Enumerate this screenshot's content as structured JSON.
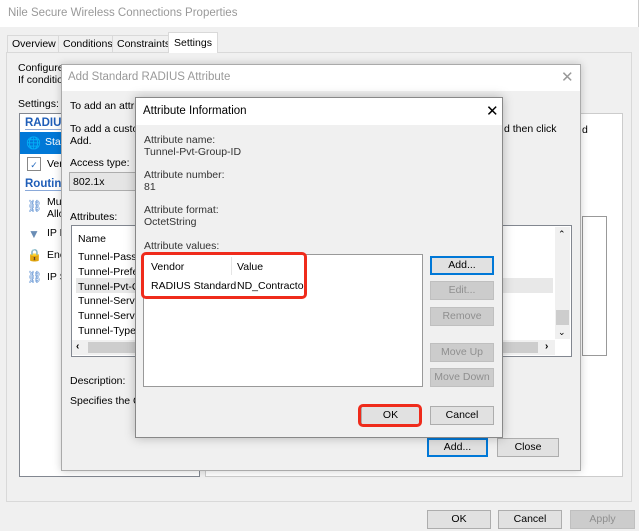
{
  "window": {
    "title": "Nile Secure Wireless Connections Properties",
    "tabs": [
      "Overview",
      "Conditions",
      "Constraints",
      "Settings"
    ],
    "selected_tab": "Settings",
    "configure_text": "Configure",
    "if_text": "If condition",
    "settings_label": "Settings:",
    "tree": {
      "radius_header": "RADIUS",
      "standard": "Sta",
      "vendor": "Ver",
      "routing_header": "Routing",
      "multilink_1": "Mu",
      "multilink_2": "Allo",
      "ip_filters": "IP F",
      "encryption": "Enc",
      "ip_settings": "IP S"
    },
    "right_fragment": "d",
    "buttons": {
      "ok": "OK",
      "cancel": "Cancel",
      "apply": "Apply"
    }
  },
  "add_dialog": {
    "title": "Add Standard RADIUS Attribute",
    "line1": "To add an attrib",
    "line2": "To add a custo",
    "line2_right": "d then click",
    "line3": "Add.",
    "access_type_label": "Access type:",
    "access_type_value": "802.1x",
    "attributes_label": "Attributes:",
    "column_name": "Name",
    "attributes": [
      "Tunnel-Passw",
      "Tunnel-Prefer",
      "Tunnel-Pvt-Gr",
      "Tunnel-Serve",
      "Tunnel-Serve",
      "Tunnel-Type"
    ],
    "selected_index": 2,
    "description_label": "Description:",
    "description_text": "Specifies the Gr",
    "add_button": "Add...",
    "close_button": "Close"
  },
  "info_dialog": {
    "title": "Attribute Information",
    "name_label": "Attribute name:",
    "name_value": "Tunnel-Pvt-Group-ID",
    "number_label": "Attribute number:",
    "number_value": "81",
    "format_label": "Attribute format:",
    "format_value": "OctetString",
    "values_label": "Attribute values:",
    "columns": [
      "Vendor",
      "Value"
    ],
    "rows": [
      {
        "vendor": "RADIUS Standard",
        "value": "ND_Contractor"
      }
    ],
    "buttons": {
      "add": "Add...",
      "edit": "Edit...",
      "remove": "Remove",
      "move_up": "Move Up",
      "move_down": "Move Down",
      "ok": "OK",
      "cancel": "Cancel"
    },
    "highlight_color": "#ef2b1b"
  }
}
